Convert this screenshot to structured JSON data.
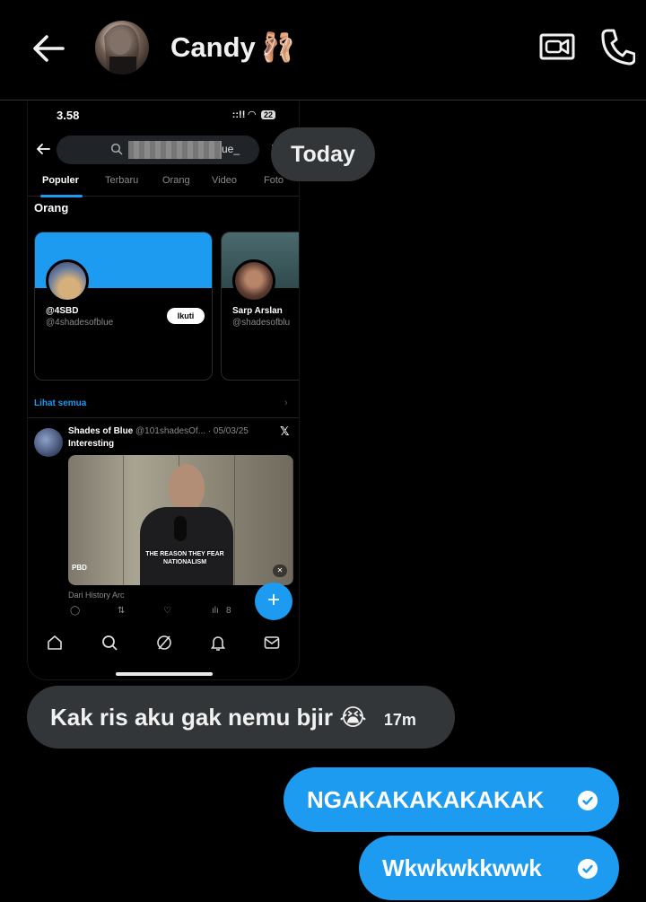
{
  "header": {
    "contact_name": "Candy",
    "name_emoji": "🩰",
    "icons": [
      "back-arrow-icon",
      "video-call-icon",
      "phone-call-icon"
    ]
  },
  "shared_screenshot": {
    "status_time": "3.58",
    "status_signal": "::!!",
    "battery": "22",
    "search_suffix": "ue_",
    "tabs": [
      "Populer",
      "Terbaru",
      "Orang",
      "Video",
      "Foto"
    ],
    "section_title": "Orang",
    "people": [
      {
        "name": "@4SBD",
        "handle": "@4shadesofblue",
        "button": "Ikuti"
      },
      {
        "name": "Sarp Arslan",
        "handle": "@shadesofblu"
      }
    ],
    "see_all": "Lihat semua",
    "post": {
      "author": "Shades of Blue",
      "meta": "@101shadesOf... · 05/03/25",
      "text": "Interesting",
      "media_caption": "THE REASON THEY FEAR NATIONALISM",
      "media_logo": "PBD",
      "source": "Dari History Arc",
      "views": "8"
    }
  },
  "messages": {
    "date_chip": "Today",
    "incoming": {
      "text": "Kak ris aku gak nemu bjir 😭",
      "time": "17m"
    },
    "outgoing": [
      {
        "text": "NGAKAKAKAKAKAK"
      },
      {
        "text": "Wkwkwkkwwk"
      }
    ]
  },
  "colors": {
    "background": "#000000",
    "incoming_bubble": "#333639",
    "outgoing_bubble": "#1d9bf0",
    "divider": "#2f3336"
  }
}
